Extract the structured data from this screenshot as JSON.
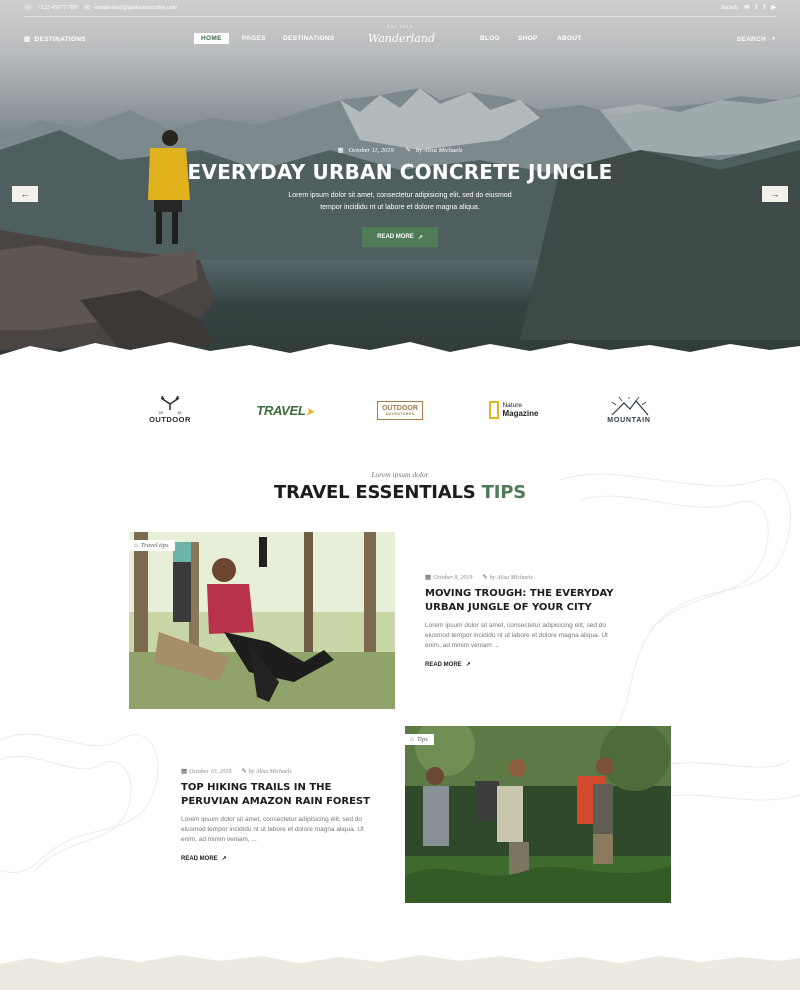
{
  "topbar": {
    "phone": "+123 45677 789",
    "email": "wanderland@qodeinteractive.com",
    "socials_label": "Socials",
    "social_icons": [
      "email-icon",
      "twitter-icon",
      "facebook-icon",
      "youtube-icon"
    ]
  },
  "nav": {
    "destinations_left": "DESTINATIONS",
    "items_left": [
      "HOME",
      "PAGES",
      "DESTINATIONS"
    ],
    "items_right": [
      "BLOG",
      "SHOP",
      "ABOUT"
    ],
    "search": "SEARCH",
    "active": "HOME"
  },
  "logo": {
    "top": "EST 2013",
    "name": "Wanderland"
  },
  "hero": {
    "date": "October 11, 2019",
    "author": "by Alisa Michaels",
    "title": "EVERYDAY URBAN CONCRETE JUNGLE",
    "excerpt": "Lorem ipsum dolor sit amet, consectetur adipisicing elit, sed do eiusmod tempor incididu nt ut labore et dolore magna aliqua.",
    "button": "READ MORE",
    "prev_icon": "arrow-left-icon",
    "next_icon": "arrow-right-icon"
  },
  "partners": {
    "p1": {
      "name": "OUTDOOR",
      "year_left": "20",
      "year_right": "15"
    },
    "p2": {
      "name": "TRAVEL"
    },
    "p3": {
      "name": "OUTDOOR",
      "sub": "ADVENTURES"
    },
    "p4": {
      "line1": "Nature",
      "line2": "Magazine"
    },
    "p5": {
      "name": "MOUNTAIN"
    }
  },
  "section": {
    "subtitle": "Lorem ipsum dolor",
    "title_main": "TRAVEL ESSENTIALS",
    "title_accent": "TIPS"
  },
  "posts": [
    {
      "tag": "Travel tips",
      "date": "October 8, 2019",
      "author": "by Alisa Michaels",
      "title": "MOVING TROUGH: THE EVERYDAY URBAN JUNGLE OF YOUR CITY",
      "excerpt": "Lorem ipsum dolor sit amet, consectetur adipisicing elit, sed do eiusmod tempor incididu nt ut labore et dolore magna aliqua. Ut enim, ad minim veniam ...",
      "read_more": "READ MORE"
    },
    {
      "tag": "Tips",
      "date": "October 10, 2019",
      "author": "by Alisa Michaels",
      "title": "TOP HIKING TRAILS IN THE PERUVIAN AMAZON RAIN FOREST",
      "excerpt": "Lorem ipsum dolor sit amet, consectetur adipisicing elit, sed do eiusmod tempor incididu nt ut labore et dolore magna aliqua. Ut enim, ad minim veniam, ...",
      "read_more": "READ MORE"
    }
  ],
  "colors": {
    "accent": "#4f7c57",
    "text": "#1d1d1d",
    "muted": "#777777"
  }
}
